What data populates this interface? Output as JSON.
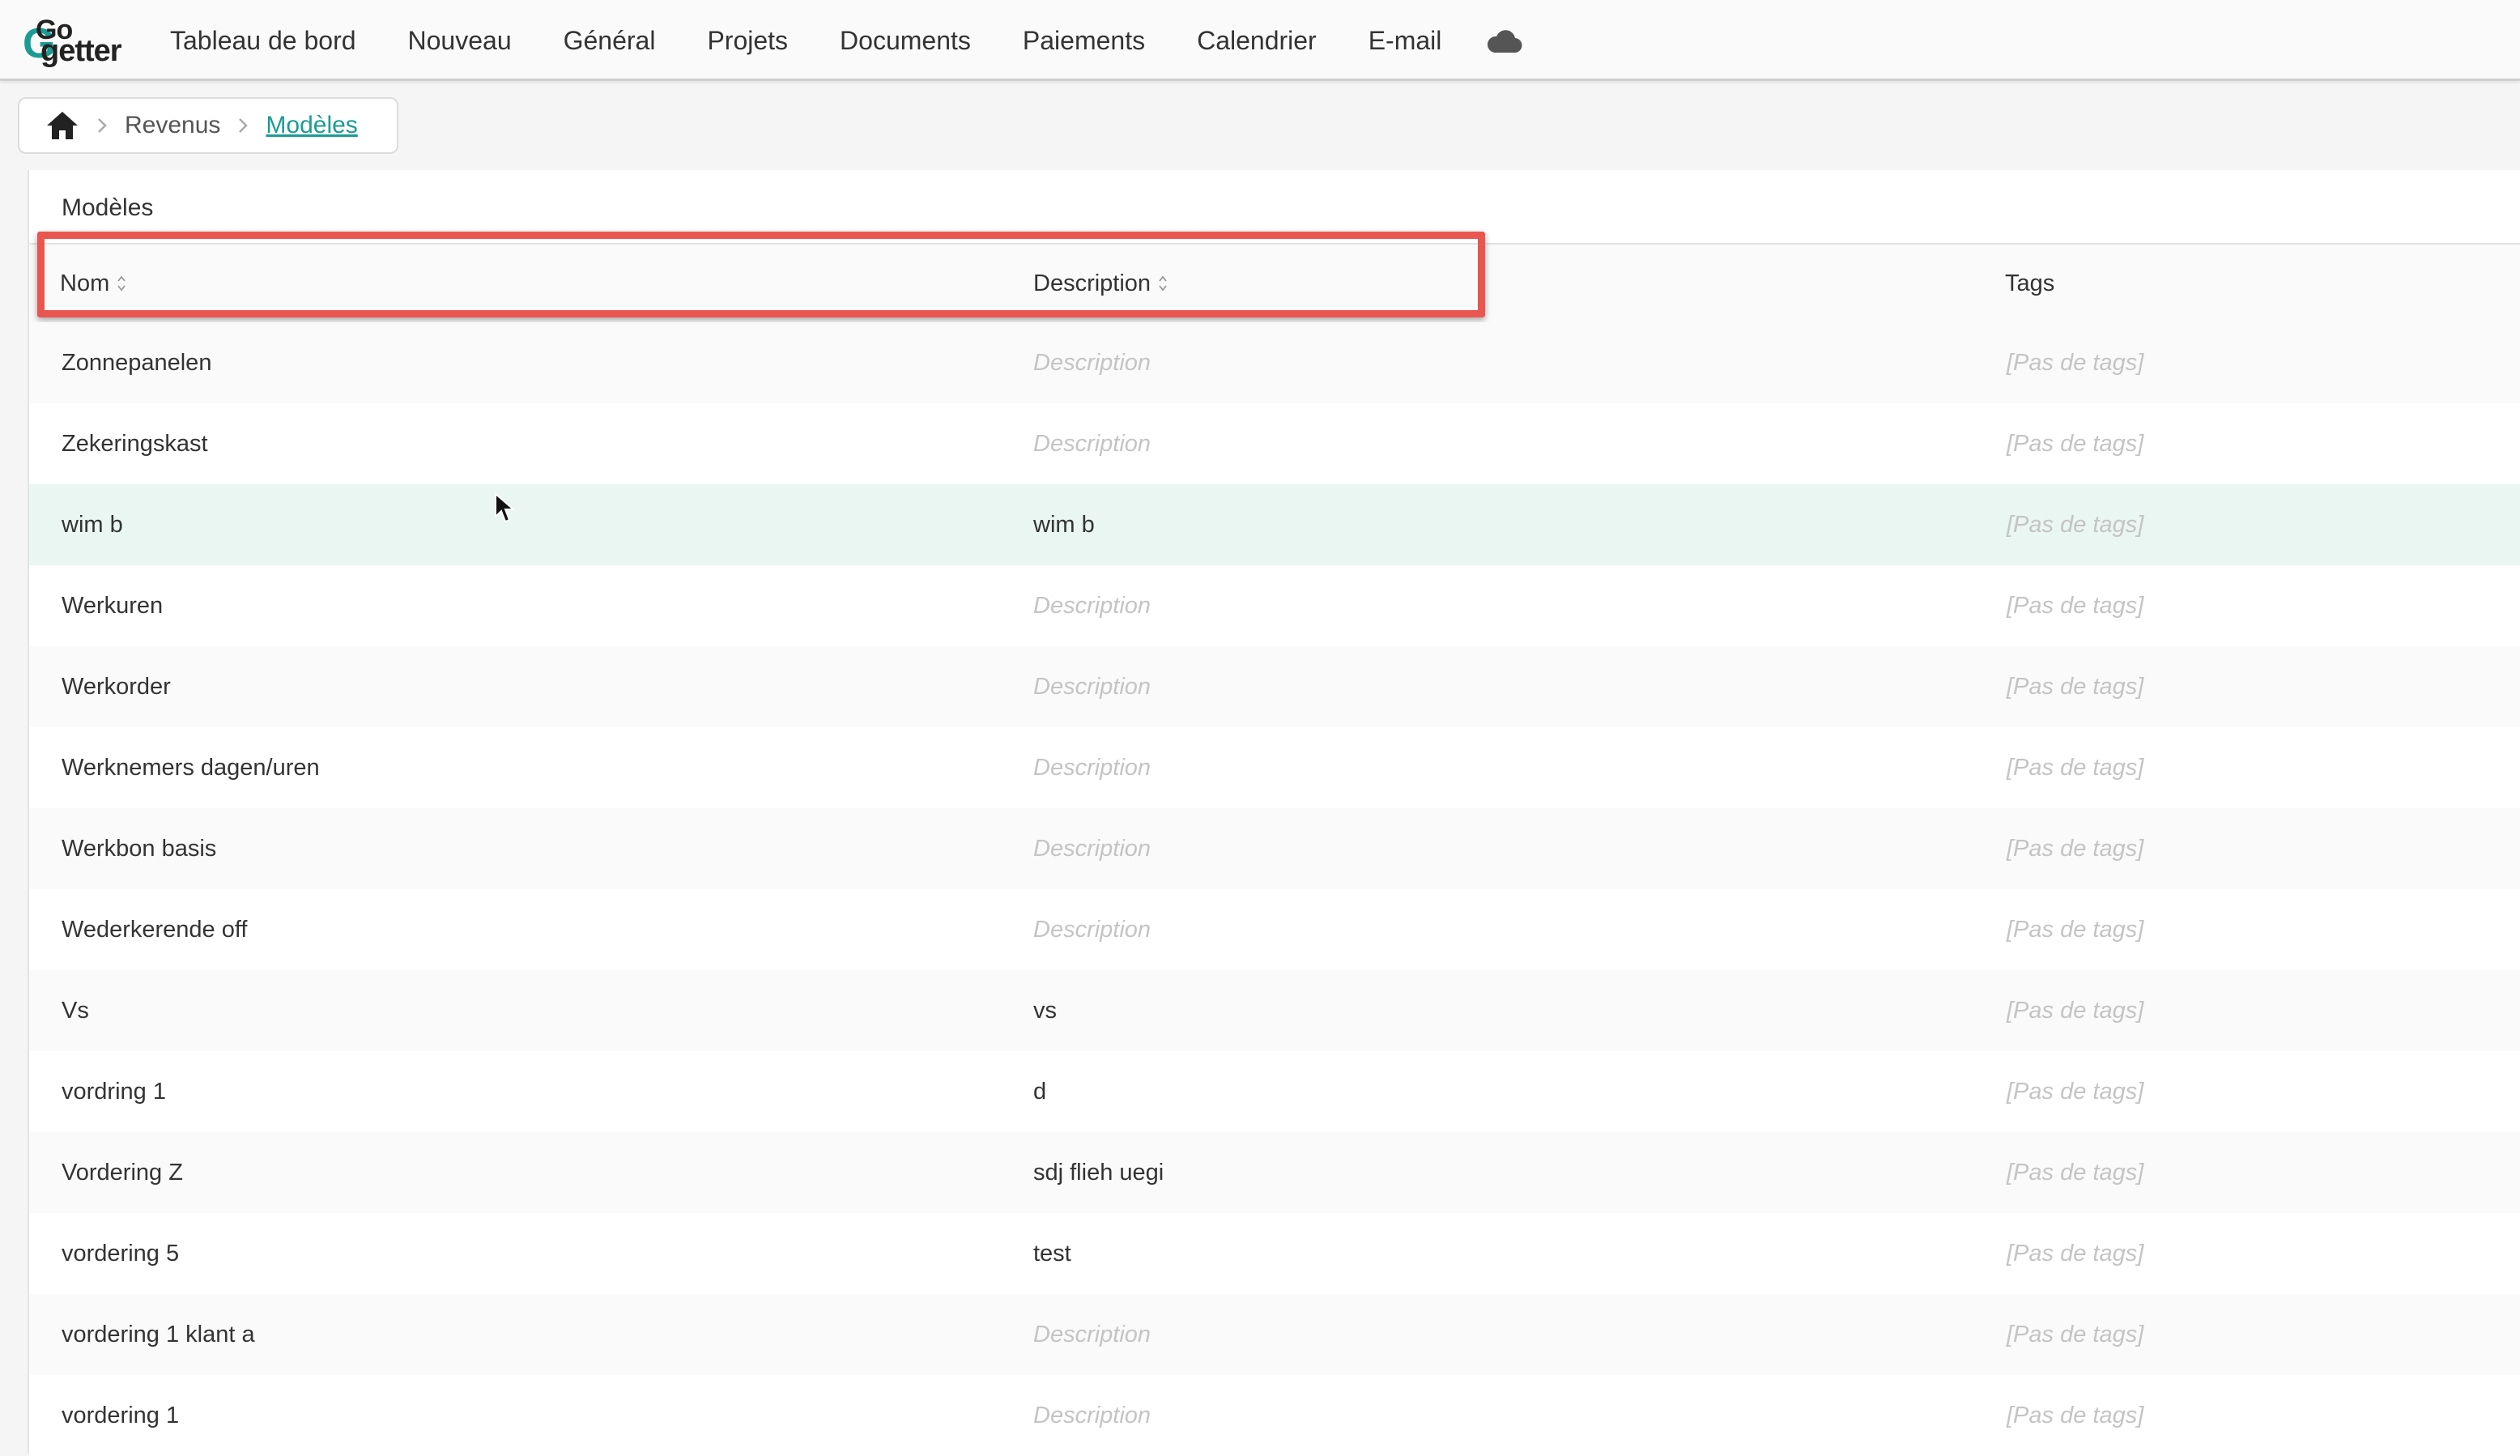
{
  "app": {
    "logo_go": "Go",
    "logo_getter": "getter",
    "logo_g": "G"
  },
  "nav": {
    "items": [
      {
        "label": "Tableau de bord",
        "name": "nav-tableau-de-bord"
      },
      {
        "label": "Nouveau",
        "name": "nav-nouveau"
      },
      {
        "label": "Général",
        "name": "nav-general"
      },
      {
        "label": "Projets",
        "name": "nav-projets"
      },
      {
        "label": "Documents",
        "name": "nav-documents"
      },
      {
        "label": "Paiements",
        "name": "nav-paiements"
      },
      {
        "label": "Calendrier",
        "name": "nav-calendrier"
      },
      {
        "label": "E-mail",
        "name": "nav-email"
      }
    ],
    "cloud_icon": "cloud-icon"
  },
  "breadcrumb": {
    "home_icon": "home-icon",
    "items": [
      "Revenus",
      "Modèles"
    ]
  },
  "panel": {
    "title": "Modèles",
    "columns": {
      "name": "Nom",
      "description": "Description",
      "tags": "Tags"
    },
    "rows": [
      {
        "name": "Zonnepanelen",
        "description": "Description",
        "desc_placeholder": true,
        "tags": "[Pas de tags]"
      },
      {
        "name": "Zekeringskast",
        "description": "Description",
        "desc_placeholder": true,
        "tags": "[Pas de tags]"
      },
      {
        "name": "wim b",
        "description": "wim b",
        "desc_placeholder": false,
        "tags": "[Pas de tags]",
        "hovered": true
      },
      {
        "name": "Werkuren",
        "description": "Description",
        "desc_placeholder": true,
        "tags": "[Pas de tags]"
      },
      {
        "name": "Werkorder",
        "description": "Description",
        "desc_placeholder": true,
        "tags": "[Pas de tags]"
      },
      {
        "name": "Werknemers dagen/uren",
        "description": "Description",
        "desc_placeholder": true,
        "tags": "[Pas de tags]"
      },
      {
        "name": "Werkbon basis",
        "description": "Description",
        "desc_placeholder": true,
        "tags": "[Pas de tags]"
      },
      {
        "name": "Wederkerende off",
        "description": "Description",
        "desc_placeholder": true,
        "tags": "[Pas de tags]"
      },
      {
        "name": "Vs",
        "description": "vs",
        "desc_placeholder": false,
        "tags": "[Pas de tags]"
      },
      {
        "name": "vordring 1",
        "description": "d",
        "desc_placeholder": false,
        "tags": "[Pas de tags]"
      },
      {
        "name": "Vordering Z",
        "description": "sdj flieh uegi",
        "desc_placeholder": false,
        "tags": "[Pas de tags]"
      },
      {
        "name": "vordering 5",
        "description": "test",
        "desc_placeholder": false,
        "tags": "[Pas de tags]"
      },
      {
        "name": "vordering 1 klant a",
        "description": "Description",
        "desc_placeholder": true,
        "tags": "[Pas de tags]"
      },
      {
        "name": "vordering 1",
        "description": "Description",
        "desc_placeholder": true,
        "tags": "[Pas de tags]"
      }
    ]
  },
  "colors": {
    "accent": "#1a9c94",
    "highlight_box": "#e8564f",
    "row_hover": "#e9f6f1",
    "placeholder_text": "#c4c4c4"
  }
}
